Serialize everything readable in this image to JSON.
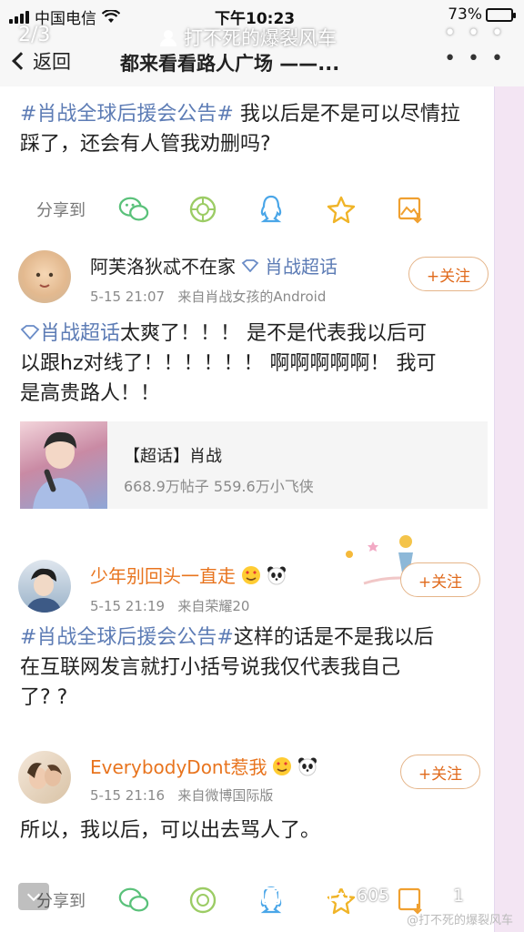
{
  "status": {
    "carrier": "中国电信",
    "time": "下午10:23",
    "battery": "73%",
    "battery_level": 0.73
  },
  "viewer": {
    "page_counter": "2/3",
    "author": "打不死的爆裂风车",
    "more": "• • •"
  },
  "nav": {
    "back_label": "返回",
    "title": "都来看看路人广场 ——...",
    "more": "• • •"
  },
  "post": {
    "topic": "#肖战全球后援会公告#",
    "text": " 我以后是不是可以尽情拉踩了，还会有人管我劝删吗?",
    "share_label": "分享到",
    "share_icons": [
      "wechat-icon",
      "moments-icon",
      "qq-icon",
      "favorite-icon",
      "save-image-icon"
    ]
  },
  "comments": [
    {
      "user": "阿芙洛狄忒不在家",
      "supertopic_tag": "肖战超话",
      "time": "5-15 21:07",
      "source": "来自肖战女孩的Android",
      "follow_label": "+关注",
      "line1_topic": "肖战超话",
      "line1": "太爽了！！！ 是不是代表我以后可",
      "line2": "以跟hz对线了！！！！！！ 啊啊啊啊啊！ 我可",
      "line3": "是高贵路人！！"
    },
    {
      "user": "少年别回头一直走",
      "time": "5-15 21:19",
      "source": "来自荣耀20",
      "follow_label": "+关注",
      "line1_topic": "#肖战全球后援会公告#",
      "line1": "这样的话是不是我以后",
      "line2": "在互联网发言就打小括号说我仅代表我自己",
      "line3": "了? ?"
    },
    {
      "user": "EverybodyDont惹我",
      "time": "5-15 21:16",
      "source": "来自微博国际版",
      "follow_label": "+关注",
      "line1": "所以，我以后，可以出去骂人了。"
    }
  ],
  "supertopic_card": {
    "title": "【超话】肖战",
    "stats": "668.9万帖子 559.6万小飞侠"
  },
  "bottom": {
    "share_label": "分享到",
    "comment_count": "605",
    "like_count": "1",
    "watermark": "@打不死的爆裂风车"
  },
  "colors": {
    "topic_blue": "#5d7cb5",
    "follow_orange": "#e06a1c",
    "username_orange": "#e8741e"
  }
}
